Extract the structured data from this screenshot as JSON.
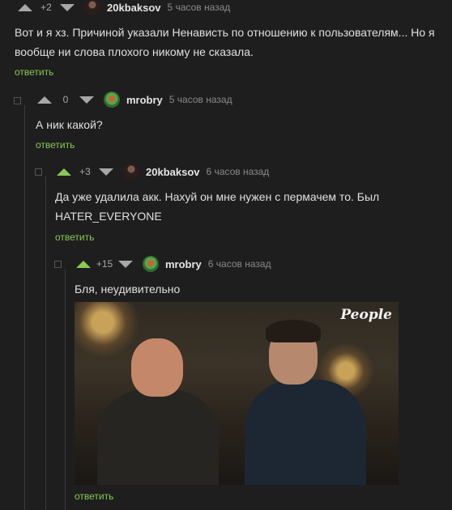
{
  "comments": [
    {
      "rating": "+2",
      "username": "20kbaksov",
      "time": "5 часов назад",
      "avatar_icon": "user-avatar-icon",
      "text": "Вот и я хз. Причиной указали Ненависть по отношению к пользователям... Но я вообще ни слова плохого никому не сказала.",
      "reply_label": "ответить"
    },
    {
      "rating": "0",
      "username": "mrobry",
      "time": "5 часов назад",
      "avatar_icon": "user-avatar-icon",
      "text": "А ник какой?",
      "reply_label": "ответить"
    },
    {
      "rating": "+3",
      "username": "20kbaksov",
      "time": "6 часов назад",
      "avatar_icon": "user-avatar-icon",
      "text": "Да уже удалила акк. Нахуй он мне нужен с пермачем то. Был HATER_EVERYONE",
      "reply_label": "ответить"
    },
    {
      "rating": "+15",
      "username": "mrobry",
      "time": "6 часов назад",
      "avatar_icon": "user-avatar-icon",
      "text": "Бля, неудивительно",
      "media_logo": "People",
      "reply_label": "ответить"
    }
  ],
  "colors": {
    "background": "#1e1e1e",
    "accent_green": "#8ac858",
    "muted": "#8a8a8a"
  }
}
